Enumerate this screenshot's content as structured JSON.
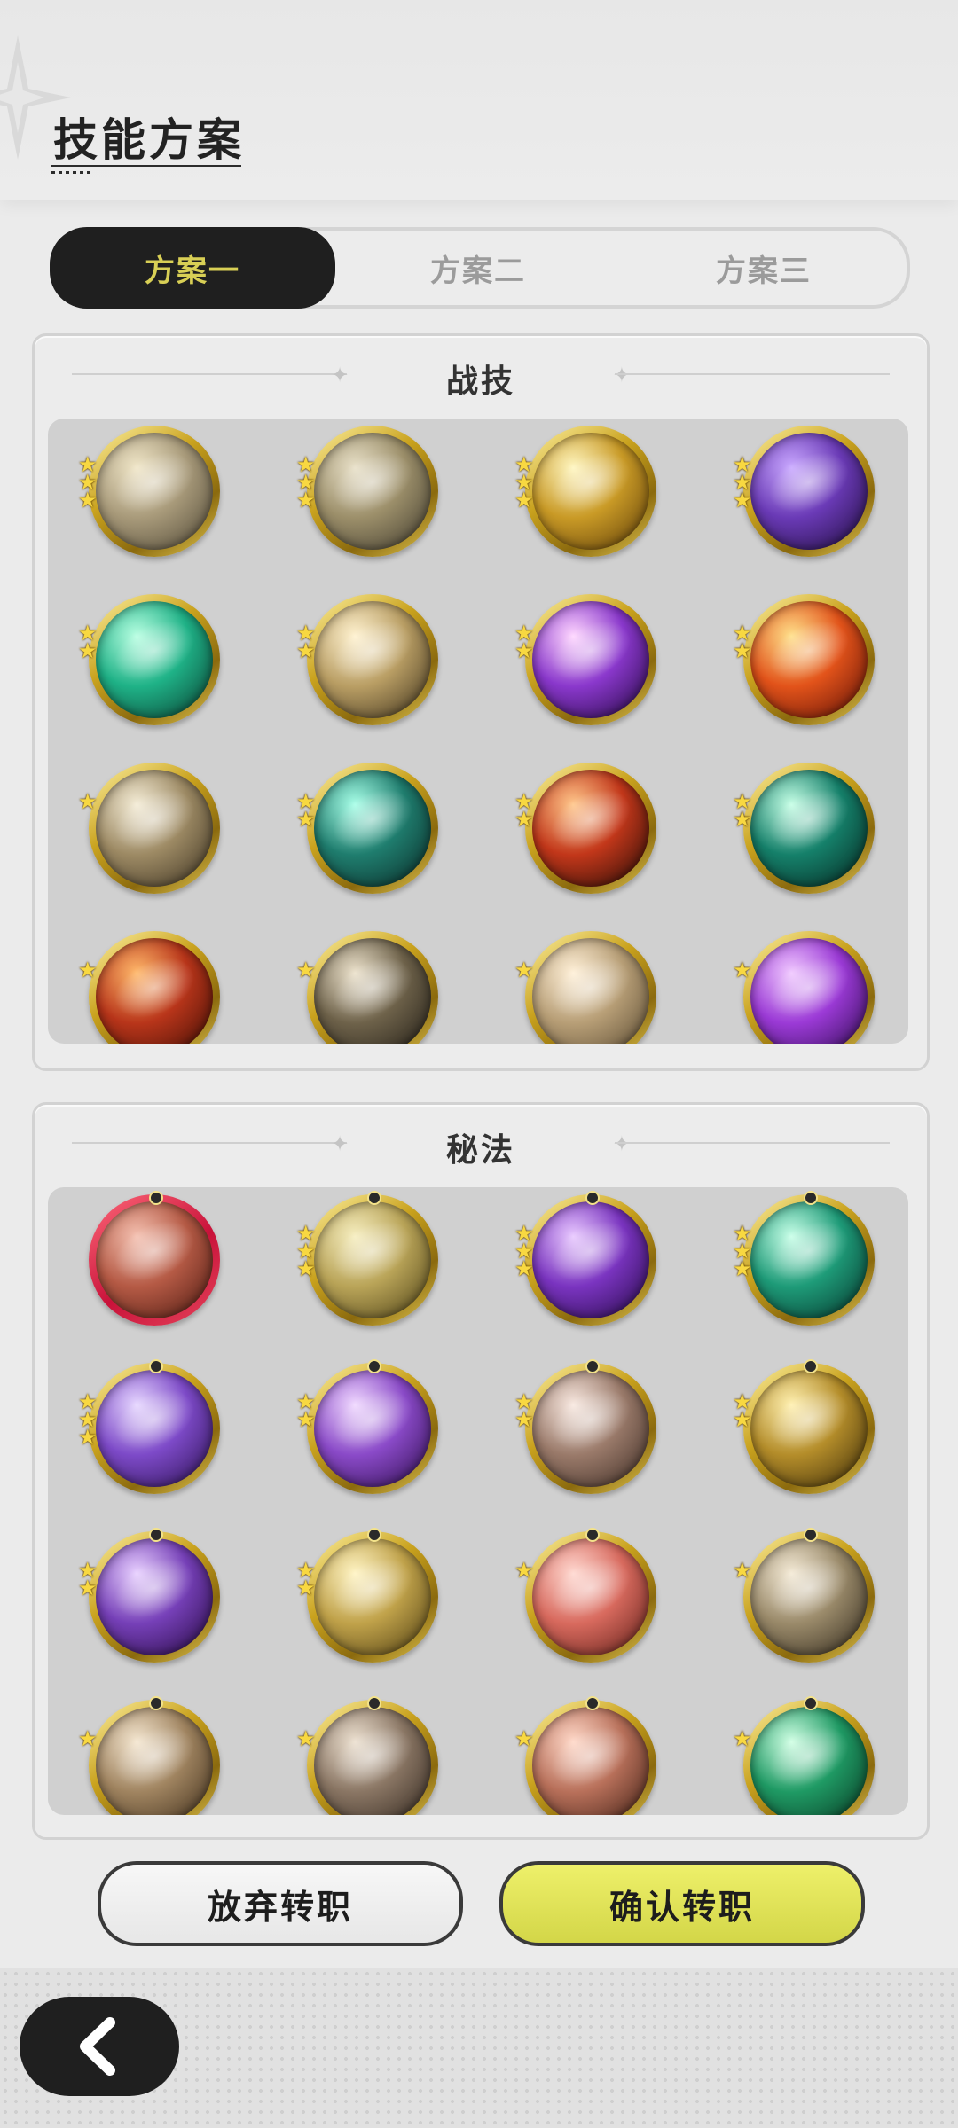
{
  "header": {
    "title": "技能方案"
  },
  "tabs": [
    {
      "label": "方案一",
      "active": true
    },
    {
      "label": "方案二",
      "active": false
    },
    {
      "label": "方案三",
      "active": false
    }
  ],
  "combat_section": {
    "title": "战技",
    "skills": [
      {
        "icon": "claw-slash-icon",
        "stars": 3,
        "colors": [
          "#f0e6c8",
          "#a89a7a",
          "#4d4534"
        ]
      },
      {
        "icon": "whirlwind-icon",
        "stars": 3,
        "colors": [
          "#e8e0c8",
          "#9c8f6a",
          "#3d382c"
        ]
      },
      {
        "icon": "crescent-strike-icon",
        "stars": 3,
        "colors": [
          "#fff6c0",
          "#c99a26",
          "#5a3a08"
        ]
      },
      {
        "icon": "shadow-grasp-icon",
        "stars": 3,
        "colors": [
          "#c9a8ff",
          "#6a3ab6",
          "#1e0c3a"
        ]
      },
      {
        "icon": "green-rising-arrows-icon",
        "stars": 2,
        "colors": [
          "#b8ffe2",
          "#1fb287",
          "#0a3b2e"
        ]
      },
      {
        "icon": "piercing-strike-icon",
        "stars": 2,
        "colors": [
          "#fff2d0",
          "#b99e64",
          "#3a2e1a"
        ]
      },
      {
        "icon": "violet-heart-burst-icon",
        "stars": 2,
        "colors": [
          "#ffd6ff",
          "#8a38cc",
          "#21073d"
        ]
      },
      {
        "icon": "flame-crest-icon",
        "stars": 2,
        "colors": [
          "#ffe08a",
          "#e2531a",
          "#5a0e06"
        ]
      },
      {
        "icon": "impact-figure-icon",
        "stars": 1,
        "colors": [
          "#f4ecd6",
          "#9d8a64",
          "#3a3020"
        ]
      },
      {
        "icon": "spider-web-icon",
        "stars": 2,
        "colors": [
          "#a8ffe8",
          "#1f7d6e",
          "#0a2724"
        ]
      },
      {
        "icon": "fire-arc-icon",
        "stars": 2,
        "colors": [
          "#ffc68a",
          "#c2371a",
          "#1e0a06"
        ]
      },
      {
        "icon": "green-sword-icon",
        "stars": 2,
        "colors": [
          "#c6ffe6",
          "#15806a",
          "#06241e"
        ]
      },
      {
        "icon": "rising-flame-icon",
        "stars": 1,
        "colors": [
          "#ffb86a",
          "#b8351a",
          "#3a0c04"
        ]
      },
      {
        "icon": "wind-slash-icon",
        "stars": 1,
        "colors": [
          "#ece2cc",
          "#6e624a",
          "#1e1a14"
        ]
      },
      {
        "icon": "tornado-icon",
        "stars": 1,
        "colors": [
          "#fff0d8",
          "#b79e76",
          "#54452e"
        ]
      },
      {
        "icon": "violet-flame-icon",
        "stars": 1,
        "colors": [
          "#f0c8ff",
          "#9b3ad6",
          "#2a0a4a"
        ]
      }
    ]
  },
  "secret_section": {
    "title": "秘法",
    "skills": [
      {
        "icon": "shatter-orb-icon",
        "stars": 0,
        "red_ring": true,
        "colors": [
          "#f4c0b0",
          "#b55a45",
          "#4a1810"
        ]
      },
      {
        "icon": "all-seeing-eye-icon",
        "stars": 3,
        "colors": [
          "#f6eec0",
          "#b9a458",
          "#4a3e14"
        ]
      },
      {
        "icon": "violet-fire-icon",
        "stars": 3,
        "colors": [
          "#e8c8ff",
          "#7a34c0",
          "#250a45"
        ]
      },
      {
        "icon": "healing-crown-icon",
        "stars": 3,
        "colors": [
          "#c8ffe8",
          "#1e9b78",
          "#06322a"
        ]
      },
      {
        "icon": "aura-figure-icon",
        "stars": 3,
        "colors": [
          "#e6d6ff",
          "#7d4ac8",
          "#2a104e"
        ]
      },
      {
        "icon": "arcane-orb-icon",
        "stars": 2,
        "colors": [
          "#f0d8ff",
          "#8a4ac8",
          "#2c0c4a"
        ]
      },
      {
        "icon": "heart-shield-icon",
        "stars": 2,
        "colors": [
          "#f8e8e0",
          "#9a7a6a",
          "#3a2a22"
        ]
      },
      {
        "icon": "golden-armor-icon",
        "stars": 2,
        "colors": [
          "#fff0b0",
          "#b48d2a",
          "#3a2a08"
        ]
      },
      {
        "icon": "phantom-wolf-icon",
        "stars": 2,
        "colors": [
          "#e8d0ff",
          "#7640b8",
          "#24083e"
        ]
      },
      {
        "icon": "holy-knight-icon",
        "stars": 2,
        "colors": [
          "#fff4c4",
          "#c0a24a",
          "#4a3a10"
        ]
      },
      {
        "icon": "blade-heal-icon",
        "stars": 1,
        "colors": [
          "#ffd8d0",
          "#d86a5e",
          "#5a1c16"
        ]
      },
      {
        "icon": "moon-leaf-icon",
        "stars": 1,
        "colors": [
          "#f4ead6",
          "#9a8a6a",
          "#2e261a"
        ]
      },
      {
        "icon": "beast-claw-icon",
        "stars": 1,
        "colors": [
          "#f4e6d0",
          "#a08460",
          "#3a2a18"
        ]
      },
      {
        "icon": "stone-fortress-icon",
        "stars": 1,
        "colors": [
          "#ece0d0",
          "#8a7664",
          "#2e241c"
        ]
      },
      {
        "icon": "crimson-rock-icon",
        "stars": 1,
        "colors": [
          "#ffd8c8",
          "#b8705a",
          "#3a1c12"
        ]
      },
      {
        "icon": "green-heart-icon",
        "stars": 1,
        "colors": [
          "#d0ffe4",
          "#1f9a64",
          "#083420"
        ]
      }
    ]
  },
  "actions": {
    "abandon_label": "放弃转职",
    "confirm_label": "确认转职"
  },
  "nav": {
    "back_icon": "chevron-left-icon"
  }
}
